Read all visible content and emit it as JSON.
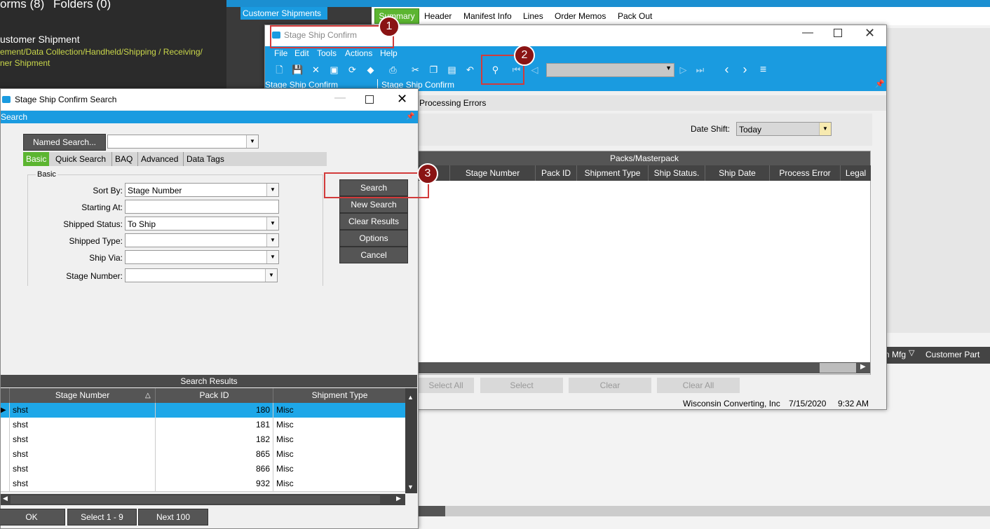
{
  "background": {
    "left_tabs_text": "orms (8)",
    "left_folders_text": "Folders (0)",
    "left_item_title": "ustomer Shipment",
    "left_item_path_1": "ement/Data Collection/Handheld/Shipping / Receiving/",
    "left_item_path_2": "ner Shipment",
    "tree_selected": "Customer Shipments",
    "tabs": [
      "Summary",
      "Header",
      "Manifest Info",
      "Lines",
      "Order Memos",
      "Pack Out"
    ],
    "right_grid_cols": [
      "n Mfg",
      "Customer Part"
    ]
  },
  "main_window": {
    "title": "Stage Ship Confirm",
    "menu": [
      "File",
      "Edit",
      "Tools",
      "Actions",
      "Help"
    ],
    "subbar_left": "Stage Ship Confirm",
    "subbar_right": "Stage Ship Confirm",
    "processing_tab": "Processing Errors",
    "date_shift_label": "Date Shift:",
    "date_shift_value": "Today",
    "grid_title": "Packs/Masterpack",
    "grid_columns": [
      "Stage Number",
      "Pack ID",
      "Shipment Type",
      "Ship Status.",
      "Ship Date",
      "Process Error",
      "Legal"
    ],
    "bottom_buttons": [
      "Select All",
      "Select",
      "Clear",
      "Clear All"
    ],
    "status_company": "Wisconsin Converting, Inc",
    "status_date": "7/15/2020",
    "status_time": "9:32 AM"
  },
  "search_window": {
    "title": "Stage Ship Confirm Search",
    "header": "Search",
    "named_search_label": "Named Search...",
    "tabs": [
      "Basic",
      "Quick Search",
      "BAQ",
      "Advanced",
      "Data Tags"
    ],
    "group_label": "Basic",
    "fields": {
      "sort_by_label": "Sort By:",
      "sort_by_value": "Stage Number",
      "starting_at_label": "Starting At:",
      "starting_at_value": "",
      "shipped_status_label": "Shipped Status:",
      "shipped_status_value": "To Ship",
      "shipped_type_label": "Shipped Type:",
      "shipped_type_value": "",
      "ship_via_label": "Ship Via:",
      "ship_via_value": "",
      "stage_number_label": "Stage Number:",
      "stage_number_value": ""
    },
    "buttons": [
      "Search",
      "New Search",
      "Clear Results",
      "Options",
      "Cancel"
    ],
    "results_title": "Search Results",
    "results_columns": [
      "Stage Number",
      "Pack ID",
      "Shipment Type"
    ],
    "results_rows": [
      [
        "shst",
        "180",
        "Misc"
      ],
      [
        "shst",
        "181",
        "Misc"
      ],
      [
        "shst",
        "182",
        "Misc"
      ],
      [
        "shst",
        "865",
        "Misc"
      ],
      [
        "shst",
        "866",
        "Misc"
      ],
      [
        "shst",
        "932",
        "Misc"
      ]
    ],
    "footer_buttons": [
      "OK",
      "Select 1 - 9",
      "Next 100"
    ]
  },
  "markers": [
    "1",
    "2",
    "3"
  ],
  "colors": {
    "accent": "#1a9be0",
    "active_tab": "#5cb531",
    "highlight": "#d23b3b",
    "marker": "#8a1414"
  }
}
